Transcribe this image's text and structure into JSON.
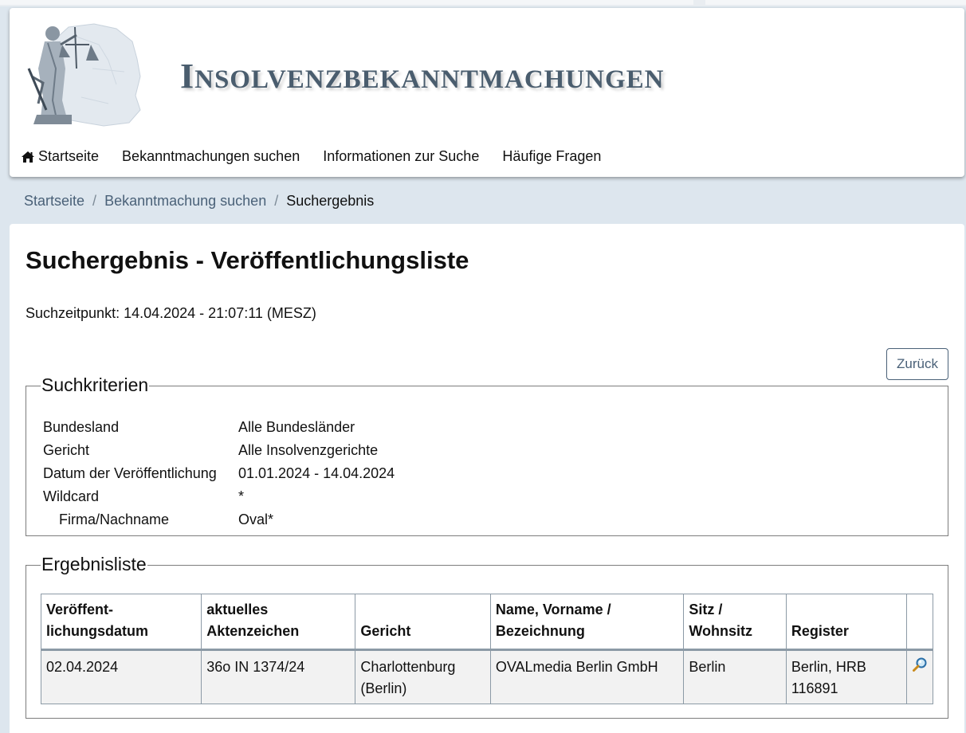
{
  "header": {
    "brand": "Insolvenzbekanntmachungen",
    "brand_first": "I",
    "brand_rest": "NSOLVENZBEKANNTMACHUNGEN"
  },
  "nav": {
    "items": [
      {
        "label": "Startseite",
        "icon": "home-icon"
      },
      {
        "label": "Bekanntmachungen suchen"
      },
      {
        "label": "Informationen zur Suche"
      },
      {
        "label": "Häufige Fragen"
      }
    ]
  },
  "breadcrumb": {
    "items": [
      "Startseite",
      "Bekanntmachung suchen"
    ],
    "current": "Suchergebnis",
    "separator": "/"
  },
  "page": {
    "title": "Suchergebnis - Veröffentlichungsliste",
    "timestamp": "Suchzeitpunkt: 14.04.2024 - 21:07:11 (MESZ)",
    "back_button": "Zurück"
  },
  "criteria": {
    "legend": "Suchkriterien",
    "rows": [
      {
        "label": "Bundesland",
        "value": "Alle Bundesländer"
      },
      {
        "label": "Gericht",
        "value": "Alle Insolvenzgerichte"
      },
      {
        "label": "Datum der Veröffentlichung",
        "value": "01.01.2024 - 14.04.2024"
      },
      {
        "label": "Wildcard",
        "value": "*"
      },
      {
        "label": "Firma/Nachname",
        "value": "Oval*"
      }
    ]
  },
  "results": {
    "legend": "Ergebnisliste",
    "columns": [
      {
        "line1": "Veröffent-",
        "line2": "lichungsdatum"
      },
      {
        "line1": "aktuelles",
        "line2": "Aktenzeichen"
      },
      {
        "line1": "",
        "line2": "Gericht"
      },
      {
        "line1": "Name, Vorname /",
        "line2": "Bezeichnung"
      },
      {
        "line1": "Sitz /",
        "line2": "Wohnsitz"
      },
      {
        "line1": "",
        "line2": "Register"
      }
    ],
    "rows": [
      {
        "datum": "02.04.2024",
        "aktenzeichen": "36o IN 1374/24",
        "gericht_1": "Charlottenburg",
        "gericht_2": "(Berlin)",
        "name": "OVALmedia Berlin GmbH",
        "sitz": "Berlin",
        "register_1": "Berlin, HRB",
        "register_2": "116891",
        "action_icon": "magnifier-icon"
      }
    ]
  },
  "colors": {
    "background": "#dde6ee",
    "link": "#4a6178",
    "brand": "#4a5d6e",
    "table_border": "#8c9aa6",
    "row_bg": "#f2f2f2"
  }
}
